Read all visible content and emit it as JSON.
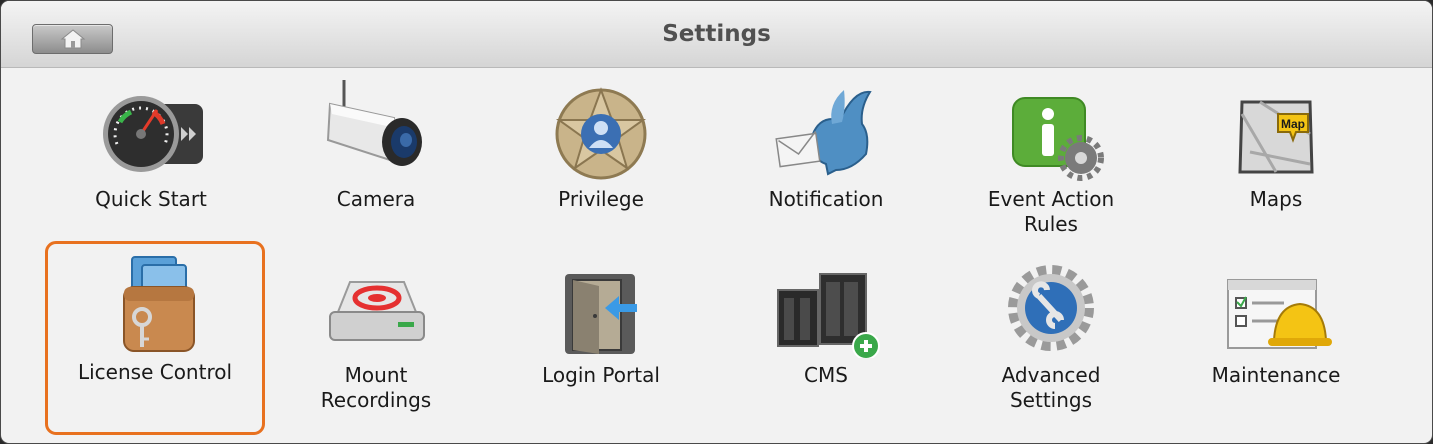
{
  "window": {
    "title": "Settings"
  },
  "items": [
    {
      "id": "quick-start",
      "label": "Quick Start",
      "icon": "speedometer-icon"
    },
    {
      "id": "camera",
      "label": "Camera",
      "icon": "security-camera-icon"
    },
    {
      "id": "privilege",
      "label": "Privilege",
      "icon": "sheriff-badge-icon"
    },
    {
      "id": "notification",
      "label": "Notification",
      "icon": "bird-with-envelope-icon"
    },
    {
      "id": "event-action-rules",
      "label": "Event Action\nRules",
      "icon": "info-gear-icon"
    },
    {
      "id": "maps",
      "label": "Maps",
      "icon": "map-icon"
    },
    {
      "id": "license-control",
      "label": "License Control",
      "icon": "wallet-key-icon",
      "selected": true
    },
    {
      "id": "mount-recordings",
      "label": "Mount\nRecordings",
      "icon": "storage-drive-icon"
    },
    {
      "id": "login-portal",
      "label": "Login Portal",
      "icon": "door-arrow-icon"
    },
    {
      "id": "cms",
      "label": "CMS",
      "icon": "nas-servers-add-icon"
    },
    {
      "id": "advanced-settings",
      "label": "Advanced\nSettings",
      "icon": "wrench-gear-icon"
    },
    {
      "id": "maintenance",
      "label": "Maintenance",
      "icon": "hardhat-checklist-icon"
    }
  ],
  "colors": {
    "selection": "#e8711f",
    "titlebar": "#e2e2e2",
    "background": "#f2f2f2"
  }
}
